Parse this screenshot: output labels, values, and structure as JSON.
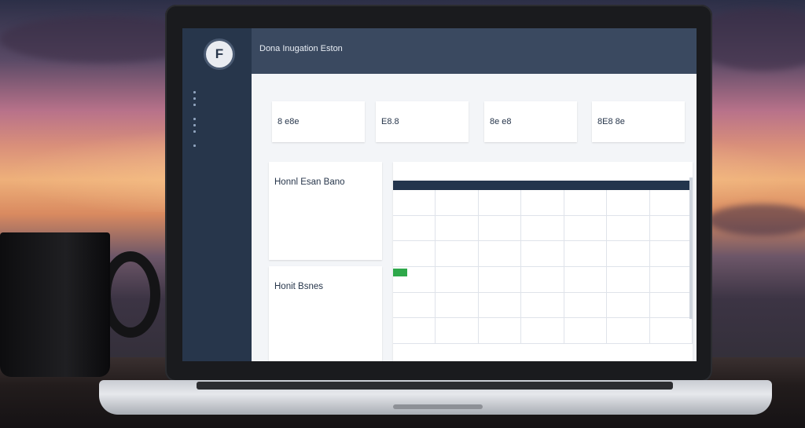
{
  "app": {
    "logo_letter": "F",
    "title": "Dona Inugation Eston",
    "subtitle": "",
    "header_tabs": [
      "",
      "",
      "",
      "",
      ""
    ],
    "header_user": [
      "",
      ""
    ]
  },
  "sidebar": {
    "sections": [
      {
        "label": "",
        "items": [
          "",
          "",
          ""
        ]
      },
      {
        "label": "",
        "items": [
          "",
          "",
          ""
        ]
      },
      {
        "label": "",
        "items": [
          ""
        ]
      }
    ]
  },
  "breadcrumb": "",
  "kpis": [
    {
      "label": "",
      "value": "8 e8e",
      "sub": ""
    },
    {
      "label": "",
      "value": "E8.8",
      "sub": ""
    },
    {
      "label": "",
      "value": "8e e8",
      "sub": ""
    },
    {
      "label": "",
      "value": "8E8 8e",
      "sub": ""
    }
  ],
  "section_label": "",
  "cards": [
    {
      "caption": "",
      "title": "Honnl Esan Bano"
    },
    {
      "caption": "",
      "title": "Honit Bsnes"
    }
  ],
  "calendar": {
    "toolbar_left": [
      "",
      ""
    ],
    "toolbar_right": [
      "",
      ""
    ],
    "sub_labels": [
      "",
      "",
      "",
      "",
      ""
    ],
    "weekdays": [
      "",
      "",
      "",
      "",
      "",
      "",
      ""
    ],
    "event_color": "#2ea84a",
    "accent_color": "#23354d"
  },
  "colors": {
    "sidebar": "#27364b",
    "header": "#3a4960",
    "background": "#f3f5f8"
  }
}
